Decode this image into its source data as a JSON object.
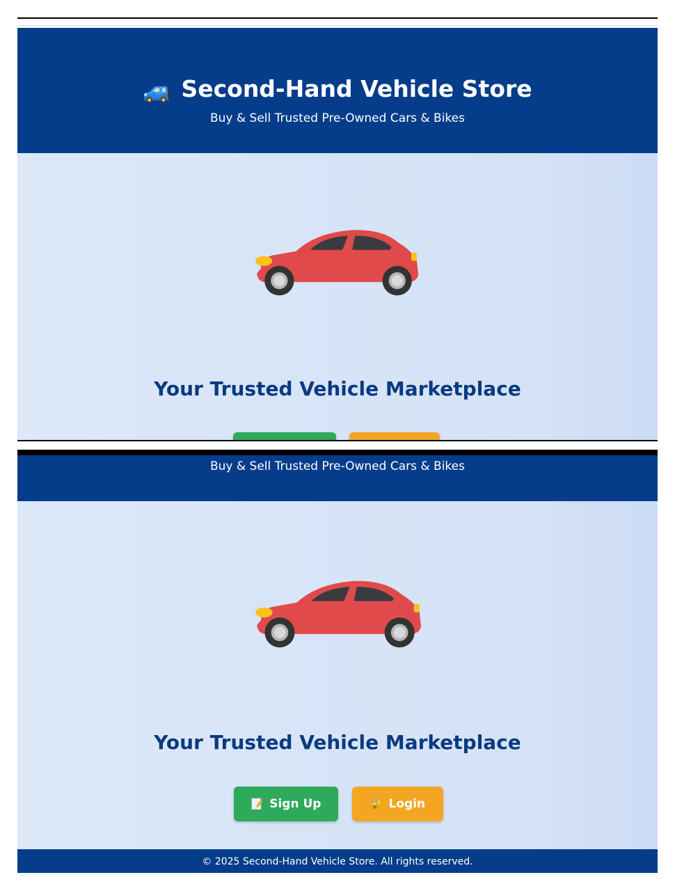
{
  "header": {
    "car_emoji": "🚙",
    "title": "Second-Hand Vehicle Store",
    "tagline": "Buy & Sell Trusted Pre-Owned Cars & Bikes"
  },
  "hero": {
    "illustration": "red-hatchback-car",
    "headline": "Your Trusted Vehicle Marketplace"
  },
  "actions": {
    "signup_icon": "📝",
    "signup_label": "Sign Up",
    "login_icon": "🔐",
    "login_label": "Login"
  },
  "footer": {
    "copyright": "© 2025 Second-Hand Vehicle Store. All rights reserved."
  },
  "colors": {
    "header_blue": "#053d8b",
    "headline_blue": "#0a3a80",
    "signup_green": "#2eaa5a",
    "login_orange": "#f4a623",
    "car_red": "#e04a4a"
  }
}
